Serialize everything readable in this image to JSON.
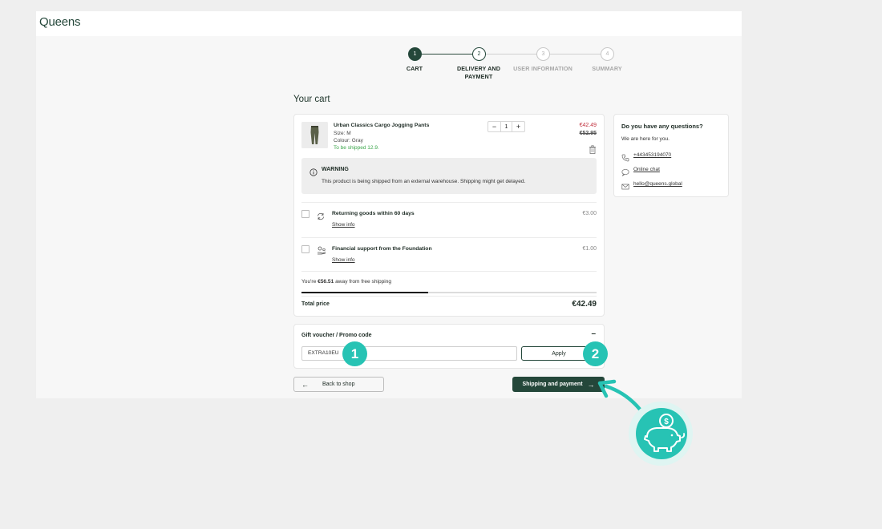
{
  "brand": {
    "name": "Queens"
  },
  "stepper": {
    "steps": [
      {
        "num": "1",
        "label": "CART"
      },
      {
        "num": "2",
        "label": "DELIVERY AND PAYMENT"
      },
      {
        "num": "3",
        "label": "USER INFORMATION"
      },
      {
        "num": "4",
        "label": "SUMMARY"
      }
    ]
  },
  "cart": {
    "title": "Your cart",
    "product": {
      "name": "Urban Classics Cargo Jogging Pants",
      "size": "Size: M",
      "colour": "Colour: Gray",
      "shipping": "To be shipped 12.9.",
      "quantity": "1",
      "price": "€42.49",
      "old_price": "€52.95"
    },
    "warning": {
      "title": "WARNING",
      "text": "This product is being shipped from an external warehouse. Shipping might get delayed."
    },
    "extras": [
      {
        "label": "Returning goods within 60 days",
        "info": "Show info",
        "price": "€3.00"
      },
      {
        "label": "Financial support from the Foundation",
        "info": "Show info",
        "price": "€1.00"
      }
    ],
    "free_shipping": {
      "prefix": "You're ",
      "amount": "€56.51",
      "suffix": " away from free shipping",
      "progress": 0.43
    },
    "total": {
      "label": "Total price",
      "value": "€42.49"
    }
  },
  "voucher": {
    "title": "Gift voucher / Promo code",
    "toggle": "–",
    "code_value": "EXTRA10EU",
    "apply_label": "Apply"
  },
  "nav": {
    "back_label": "Back to shop",
    "next_label": "Shipping and payment"
  },
  "help": {
    "title": "Do you have any questions?",
    "subtitle": "We are here for you.",
    "phone": "+443453194070",
    "chat": "Online chat",
    "email": "hello@queens.global"
  },
  "markers": [
    "1",
    "2"
  ],
  "colors": {
    "brand_dark": "#254a3a",
    "accent_teal": "#27c3b4",
    "sale_red": "#c1313e",
    "ship_green": "#3aa64a"
  }
}
